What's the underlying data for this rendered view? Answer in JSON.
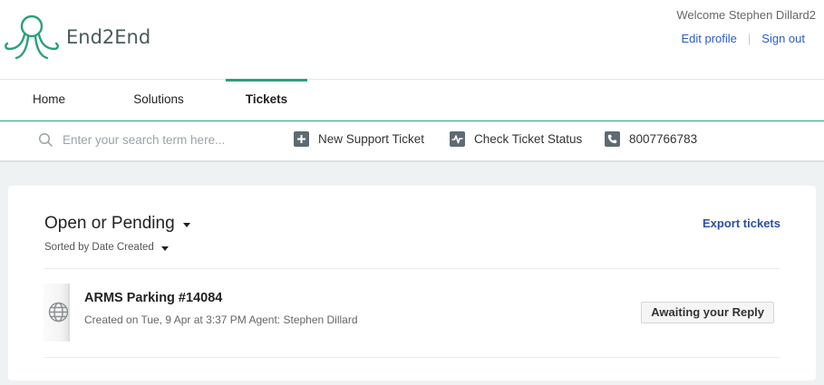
{
  "brand": {
    "name": "End2End",
    "color": "#2e9e7e"
  },
  "user": {
    "welcome": "Welcome Stephen Dillard2",
    "edit_profile": "Edit profile",
    "sign_out": "Sign out"
  },
  "nav": {
    "tabs": [
      {
        "label": "Home",
        "active": false
      },
      {
        "label": "Solutions",
        "active": false
      },
      {
        "label": "Tickets",
        "active": true
      }
    ]
  },
  "actionbar": {
    "search_placeholder": "Enter your search term here...",
    "new_ticket": "New Support Ticket",
    "check_status": "Check Ticket Status",
    "phone": "8007766783"
  },
  "tickets_view": {
    "filter_label": "Open or Pending",
    "sort_label": "Sorted by Date Created",
    "export_label": "Export tickets",
    "tickets": [
      {
        "title": "ARMS Parking #14084",
        "meta": "Created on Tue, 9 Apr at 3:37 PM Agent: Stephen Dillard",
        "status": "Awaiting your Reply",
        "icon": "globe-icon"
      }
    ]
  }
}
